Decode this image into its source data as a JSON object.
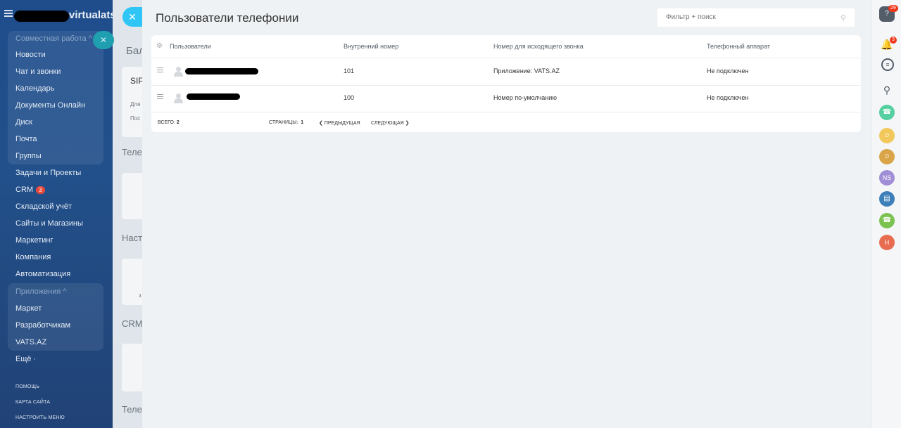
{
  "sidebar": {
    "logo_text": "virtualats",
    "group1_header": "Совместная работа ^",
    "items": [
      "Новости",
      "Чат и звонки",
      "Календарь",
      "Документы Онлайн",
      "Диск",
      "Почта",
      "Группы",
      "Задачи и Проекты",
      "CRM",
      "Складской учёт",
      "Сайты и Магазины",
      "Маркетинг",
      "Компания",
      "Автоматизация"
    ],
    "crm_badge": "3",
    "group2_header": "Приложения ^",
    "apps": [
      "Маркет",
      "Разработчикам",
      "VATS.AZ"
    ],
    "more": "Ещё ·",
    "bottom": [
      "помощь",
      "карта сайта",
      "настроить меню"
    ]
  },
  "bgpage": {
    "texts": [
      "Бал",
      "SIP",
      "Для",
      "Пос",
      "Теле",
      "Настр",
      "з",
      "CRM-",
      "Телеф"
    ]
  },
  "slider": {
    "title": "Пользователи телефонии",
    "search_placeholder": "Фильтр + поиск",
    "columns": [
      "Пользователи",
      "Внутренний номер",
      "Номер для исходящего звонка",
      "Телефонный аппарат"
    ],
    "rows": [
      {
        "ext": "101",
        "outgoing": "Приложение: VATS.AZ",
        "device": "Не подключен"
      },
      {
        "ext": "100",
        "outgoing": "Номер по-умолчанию",
        "device": "Не подключен"
      }
    ],
    "footer": {
      "total_label": "Всего:",
      "total": "2",
      "pages_label": "Страницы:",
      "page": "1",
      "prev": "Предыдущая",
      "next": "Следующая"
    }
  },
  "rightbar": {
    "help_badge": "29",
    "bell_badge": "3",
    "avatar_ns": "NS",
    "avatar_h": "H"
  },
  "colors": {
    "accent": "#2fc6f6",
    "sidebar": "#1f4d8c",
    "badge": "#f0371b"
  }
}
